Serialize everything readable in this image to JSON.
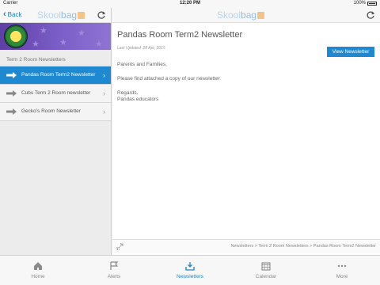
{
  "status": {
    "carrier": "Carrier",
    "time": "12:20 PM",
    "battery": "100%"
  },
  "header": {
    "back_label": "Back",
    "brand_part1": "Skool",
    "brand_part2": "bag"
  },
  "sidebar": {
    "section_label": "Term 2 Room Newsletters",
    "items": [
      {
        "label": "Pandas Room Term2 Newsletter",
        "active": true
      },
      {
        "label": "Cubs Term 2 Room newsletter",
        "active": false
      },
      {
        "label": "Gecko's Room Newsletter",
        "active": false
      }
    ]
  },
  "article": {
    "title": "Pandas Room Term2 Newsletter",
    "updated": "Last Updated: 28 Apr, 2015",
    "view_button": "View Newsletter",
    "body": [
      "Parents and Families,",
      "Please find attached a copy of our newsletter.",
      "Regards,",
      "Pandas educators"
    ]
  },
  "breadcrumb": "Newsletters > Term 2 Room Newsletters > Pandas Room Term2 Newsletter",
  "tabs": [
    {
      "label": "Home",
      "icon": "home-icon",
      "active": false
    },
    {
      "label": "Alerts",
      "icon": "flag-icon",
      "active": false
    },
    {
      "label": "Newsletters",
      "icon": "download-icon",
      "active": true
    },
    {
      "label": "Calendar",
      "icon": "calendar-icon",
      "active": false
    },
    {
      "label": "More",
      "icon": "more-icon",
      "active": false
    }
  ],
  "colors": {
    "accent": "#1e88d0",
    "banner": "#6a4cb4"
  }
}
